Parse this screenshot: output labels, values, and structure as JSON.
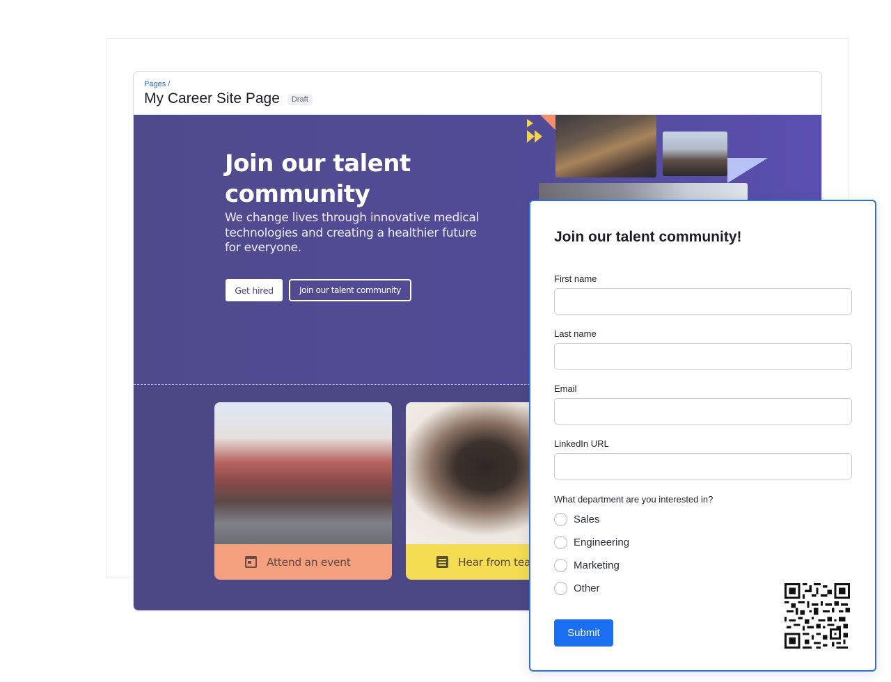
{
  "editor": {
    "breadcrumb": "Pages /",
    "title": "My Career Site Page",
    "status_badge": "Draft"
  },
  "hero": {
    "title": "Join our talent community",
    "subtitle": "We change lives through innovative medical technologies and creating a healthier future for everyone.",
    "primary_button": "Get hired",
    "secondary_button": "Join our talent community",
    "background_color": "#4f4a8c"
  },
  "cards": [
    {
      "label": "Attend an event",
      "icon": "calendar-icon",
      "color": "#f4a07f"
    },
    {
      "label": "Hear from teammates",
      "icon": "article-icon",
      "color": "#f4dc53"
    }
  ],
  "form": {
    "title": "Join our talent community!",
    "fields": [
      {
        "label": "First name",
        "value": ""
      },
      {
        "label": "Last name",
        "value": ""
      },
      {
        "label": "Email",
        "value": ""
      },
      {
        "label": "LinkedIn URL",
        "value": ""
      }
    ],
    "department_question": "What department are you interested in?",
    "departments": [
      "Sales",
      "Engineering",
      "Marketing",
      "Other"
    ],
    "submit_label": "Submit",
    "accent_color": "#1a6ff0",
    "qr_icon": "qr-code-icon"
  }
}
